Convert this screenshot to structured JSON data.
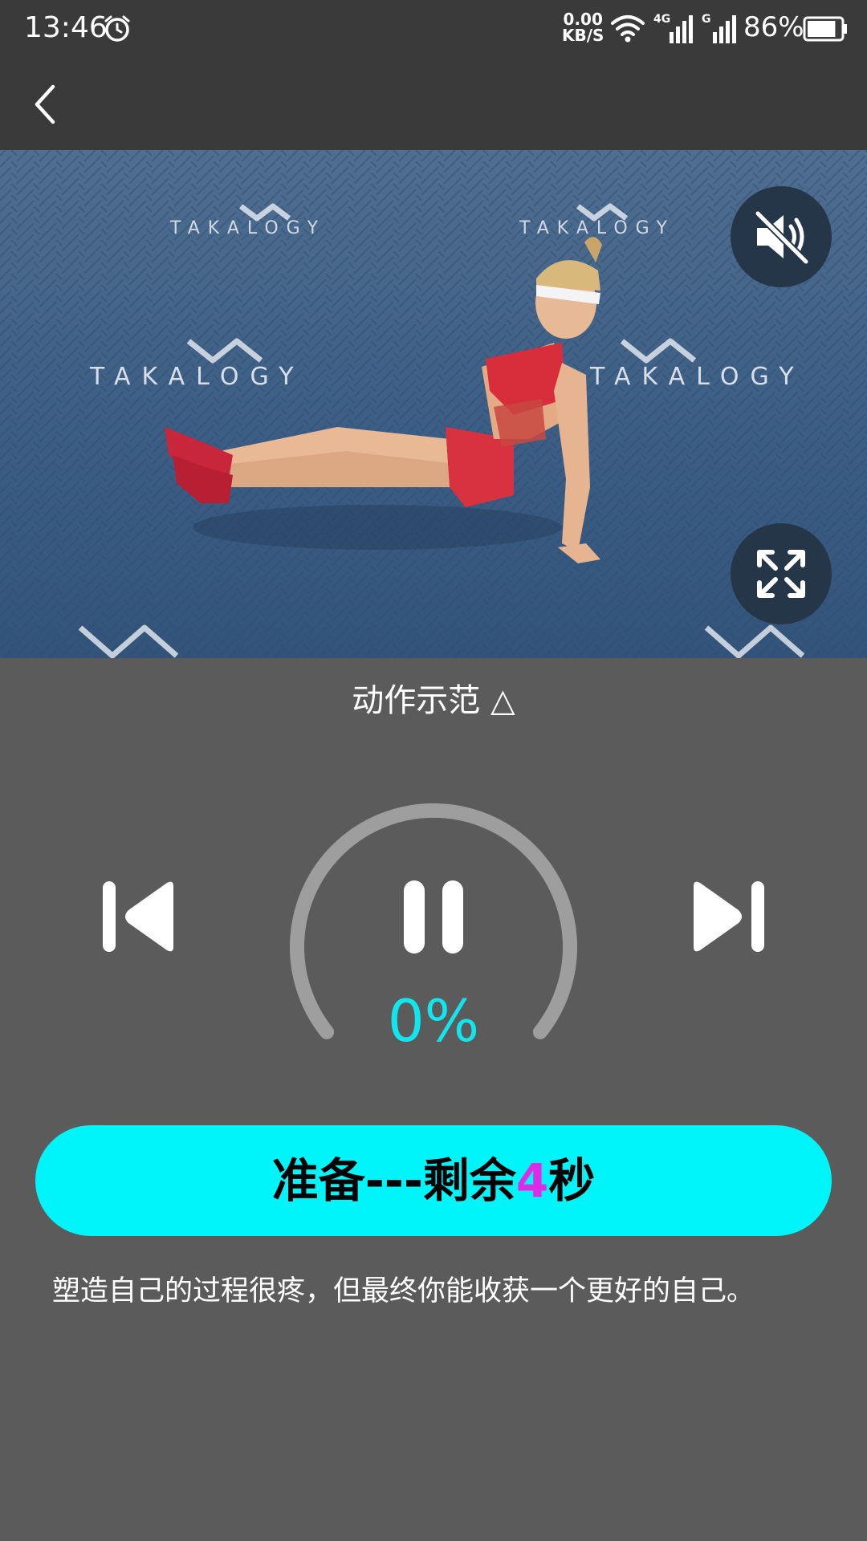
{
  "status_bar": {
    "time": "13:46",
    "net_speed_value": "0.00",
    "net_speed_unit": "KB/S",
    "signal1_label": "4G",
    "signal2_label": "G",
    "battery": "86%",
    "battery_level": 0.86
  },
  "video": {
    "watermark": "TAKALOGY",
    "muted": true
  },
  "demo_label": "动作示范 △",
  "player": {
    "progress": "0%",
    "progress_value": 0
  },
  "ready_button": {
    "prefix": "准备---剩余",
    "seconds": "4",
    "suffix": "秒"
  },
  "motto": "塑造自己的过程很疼，但最终你能收获一个更好的自己。",
  "colors": {
    "accent": "#00f5fa",
    "progress_text": "#11e6ee",
    "countdown_number": "#e02be6",
    "background": "#5b5b5b",
    "bar": "#3a3a3a"
  }
}
